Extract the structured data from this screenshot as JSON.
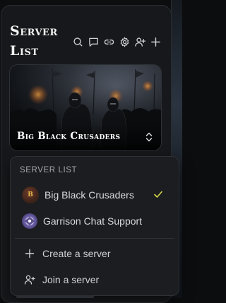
{
  "sidebar": {
    "title": "Server List",
    "toolbar": {
      "icons": [
        "search-icon",
        "chat-icon",
        "link-icon",
        "gear-icon",
        "add-user-icon",
        "plus-icon"
      ]
    },
    "current_server": {
      "name": "Big Black Crusaders"
    }
  },
  "dropdown": {
    "heading": "SERVER LIST",
    "servers": [
      {
        "name": "Big Black Crusaders",
        "avatar_letter": "B",
        "selected": true
      },
      {
        "name": "Garrison Chat Support",
        "selected": false
      }
    ],
    "actions": [
      {
        "label": "Create a server",
        "icon": "plus-icon"
      },
      {
        "label": "Join a server",
        "icon": "add-user-icon"
      }
    ]
  },
  "colors": {
    "accent_check": "#d6d64a",
    "panel_bg": "#16181b",
    "dropdown_bg": "#1b1d20"
  }
}
